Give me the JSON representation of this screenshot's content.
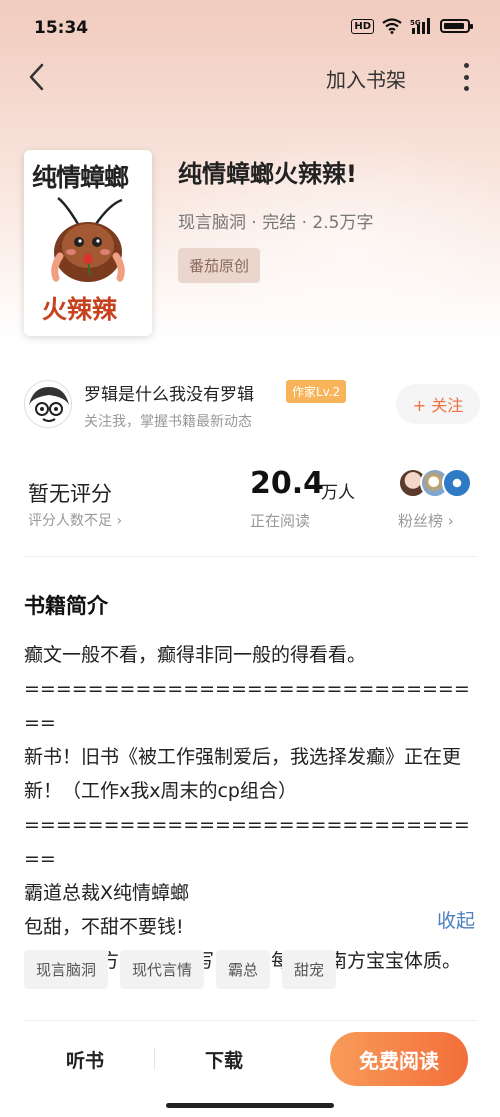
{
  "status_bar": {
    "time": "15:34",
    "hd": "HD",
    "network": "5G"
  },
  "nav": {
    "add_to_shelf": "加入书架"
  },
  "cover": {
    "title_top": "纯情蟑螂",
    "title_bottom": "火辣辣"
  },
  "book": {
    "title": "纯情蟑螂火辣辣!",
    "meta": "现言脑洞 · 完结 · 2.5万字",
    "publisher_tag": "番茄原创"
  },
  "author": {
    "name": "罗辑是什么我没有罗辑",
    "level": "作家Lv.2",
    "subtitle": "关注我，掌握书籍最新动态",
    "follow_label": "+ 关注"
  },
  "stats": {
    "rating": "暂无评分",
    "rating_sub": "评分人数不足 ›",
    "reading_num": "20.4",
    "reading_unit": "万人",
    "reading_sub": "正在阅读",
    "fans_sub": "粉丝榜 ›"
  },
  "intro": {
    "heading": "书籍简介",
    "text": "癫文一般不看，癫得非同一般的得看看。\n==============================\n新书！旧书《被工作强制爱后，我选择发癫》正在更新！（工作x我x周末的cp组合）\n==============================\n霸道总裁X纯情蟑螂\n包甜，不甜不要钱!\n本文由南方人亲自撰写，适合每一个南方宝宝体质。",
    "collapse_label": "收起"
  },
  "tags": [
    "现言脑洞",
    "现代言情",
    "霸总",
    "甜宠"
  ],
  "bottom_bar": {
    "listen": "听书",
    "download": "下载",
    "read": "免费阅读"
  },
  "colors": {
    "accent": "#f36f3a",
    "link": "#4a7fc0",
    "level_badge": "#f7b45a"
  },
  "icons": {
    "back": "chevron-left-icon",
    "more": "more-vertical-icon",
    "wifi": "wifi-icon",
    "signal": "signal-icon",
    "battery": "battery-icon"
  }
}
